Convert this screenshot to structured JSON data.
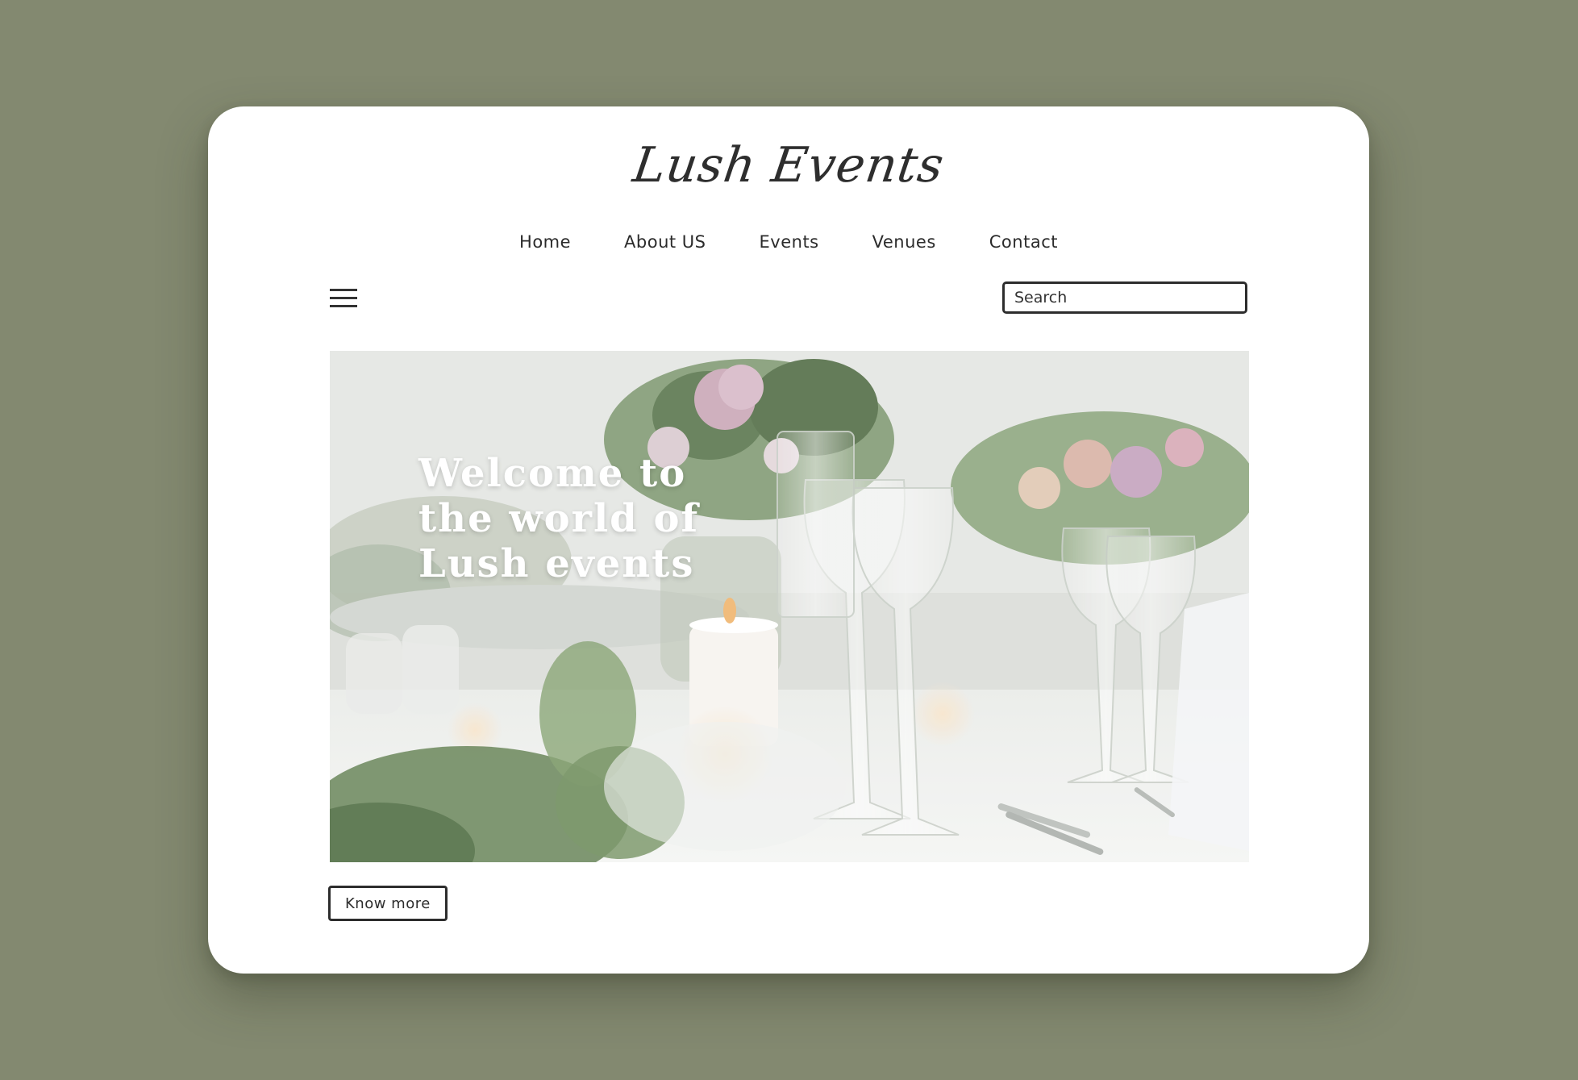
{
  "brand": {
    "logo_text": "Lush Events"
  },
  "nav": {
    "items": [
      {
        "label": "Home"
      },
      {
        "label": "About US"
      },
      {
        "label": "Events"
      },
      {
        "label": "Venues"
      },
      {
        "label": "Contact"
      }
    ]
  },
  "toolbar": {
    "menu_icon": "hamburger-menu-icon",
    "search_placeholder": "Search"
  },
  "hero": {
    "title": "Welcome to the world of Lush events",
    "image_subject": "table-setting-with-flowers-and-wine-glasses"
  },
  "cta": {
    "know_more_label": "Know more"
  },
  "colors": {
    "background": "#838970",
    "card": "#ffffff",
    "text": "#2d2d2d",
    "hero_text": "#ffffff"
  }
}
